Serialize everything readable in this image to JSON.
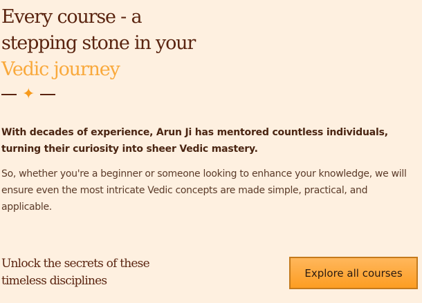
{
  "heading": {
    "line1": "Every course - a",
    "line2": "stepping stone in your",
    "accent": "Vedic journey"
  },
  "divider": {
    "icon": "sparkle-icon",
    "accent_color": "#f79a1c"
  },
  "intro": "With decades of experience, Arun Ji has mentored countless individuals, turning their curiosity into sheer Vedic mastery.",
  "description": "So, whether you're a beginner or someone looking to enhance your knowledge, we will ensure even the most intricate Vedic concepts are made simple, practical, and applicable.",
  "cta": {
    "text_line1": "Unlock the secrets of these",
    "text_line2": "timeless disciplines",
    "button_label": "Explore all courses"
  },
  "colors": {
    "background": "#fef0e0",
    "heading": "#5a2410",
    "accent": "#f9a93c",
    "button": "#fd9d22"
  }
}
